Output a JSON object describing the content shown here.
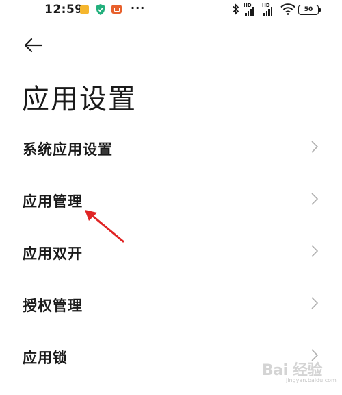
{
  "status_bar": {
    "time": "12:59",
    "more": "···",
    "signal1_label": "HD",
    "signal2_label": "HD",
    "battery": "50",
    "icons": [
      "message-notification-icon",
      "shield-icon",
      "video-icon",
      "bluetooth-icon",
      "signal-icon",
      "signal-icon",
      "wifi-icon",
      "battery-icon"
    ]
  },
  "header": {
    "back_icon": "back-arrow-icon",
    "title": "应用设置"
  },
  "list": {
    "items": [
      {
        "label": "系统应用设置"
      },
      {
        "label": "应用管理"
      },
      {
        "label": "应用双开"
      },
      {
        "label": "授权管理"
      },
      {
        "label": "应用锁"
      }
    ]
  },
  "annotation": {
    "color": "#e02424"
  },
  "watermark": {
    "text": "Bai 经验",
    "sub": "jingyan.baidu.com"
  }
}
